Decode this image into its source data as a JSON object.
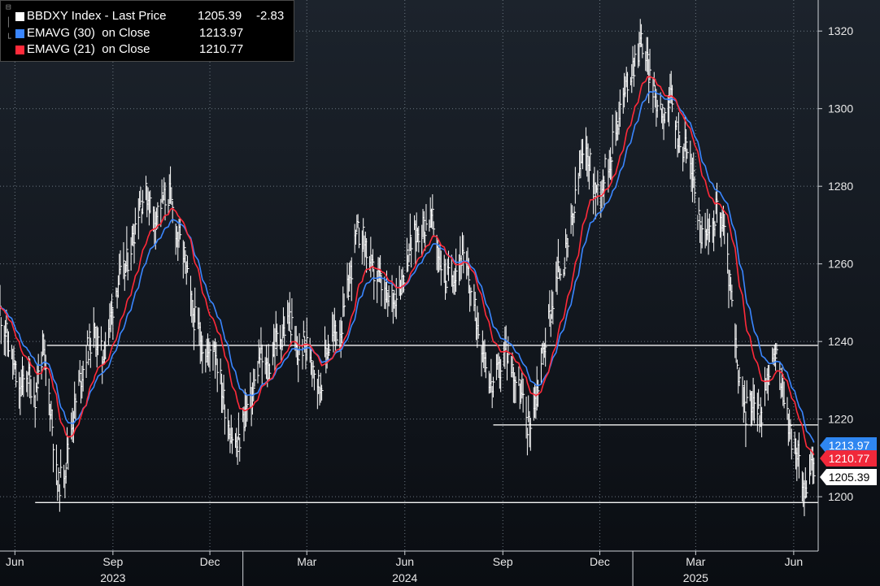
{
  "legend": {
    "items": [
      {
        "name": "BBDXY Index - Last Price",
        "value": "1205.39",
        "change": "-2.83",
        "color": "#ffffff"
      },
      {
        "name": "EMAVG (30)  on Close",
        "value": "1213.97",
        "color": "#3a86ff"
      },
      {
        "name": "EMAVG (21)  on Close",
        "value": "1210.77",
        "color": "#ff2a3a"
      }
    ]
  },
  "tags": {
    "ema30": "1213.97",
    "ema21": "1210.77",
    "last": "1205.39"
  },
  "chart_data": {
    "type": "line",
    "y_axis_side": "right",
    "ylim": [
      1186,
      1328
    ],
    "y_ticks": [
      1200,
      1220,
      1240,
      1260,
      1280,
      1300,
      1320
    ],
    "grid": true,
    "x_ticks": [
      {
        "label": "Jun",
        "date": "2023-06-01"
      },
      {
        "label": "Sep",
        "date": "2023-09-01"
      },
      {
        "label": "Dec",
        "date": "2023-12-01"
      },
      {
        "label": "Mar",
        "date": "2024-03-01"
      },
      {
        "label": "Jun",
        "date": "2024-06-01"
      },
      {
        "label": "Sep",
        "date": "2024-09-01"
      },
      {
        "label": "Dec",
        "date": "2024-12-01"
      },
      {
        "label": "Mar",
        "date": "2025-03-01"
      },
      {
        "label": "Jun",
        "date": "2025-06-01"
      }
    ],
    "year_labels": [
      {
        "label": "2023",
        "date": "2023-09-01"
      },
      {
        "label": "2024",
        "date": "2024-06-01"
      },
      {
        "label": "2025",
        "date": "2025-03-01"
      }
    ],
    "year_dividers": [
      "2024-01-01",
      "2025-01-01"
    ],
    "xlim": [
      "2023-05-18",
      "2025-06-24"
    ],
    "horizontal_lines": [
      {
        "value": 1239,
        "start": "2023-07-01",
        "end": "2025-06-24"
      },
      {
        "value": 1218.5,
        "start": "2024-08-23",
        "end": "2025-06-24"
      },
      {
        "value": 1198.5,
        "start": "2023-06-20",
        "end": "2025-06-24"
      }
    ],
    "price_anchors": [
      [
        "2023-05-18",
        1248
      ],
      [
        "2023-05-29",
        1236
      ],
      [
        "2023-06-05",
        1226
      ],
      [
        "2023-06-12",
        1232
      ],
      [
        "2023-06-20",
        1226
      ],
      [
        "2023-06-27",
        1238
      ],
      [
        "2023-07-05",
        1222
      ],
      [
        "2023-07-11",
        1202
      ],
      [
        "2023-07-18",
        1208
      ],
      [
        "2023-07-25",
        1220
      ],
      [
        "2023-08-01",
        1230
      ],
      [
        "2023-08-08",
        1238
      ],
      [
        "2023-08-15",
        1242
      ],
      [
        "2023-08-22",
        1236
      ],
      [
        "2023-08-29",
        1245
      ],
      [
        "2023-09-05",
        1255
      ],
      [
        "2023-09-12",
        1258
      ],
      [
        "2023-09-19",
        1266
      ],
      [
        "2023-09-26",
        1276
      ],
      [
        "2023-10-03",
        1278
      ],
      [
        "2023-10-10",
        1272
      ],
      [
        "2023-10-17",
        1276
      ],
      [
        "2023-10-24",
        1278
      ],
      [
        "2023-10-31",
        1268
      ],
      [
        "2023-11-07",
        1262
      ],
      [
        "2023-11-14",
        1248
      ],
      [
        "2023-11-21",
        1242
      ],
      [
        "2023-11-28",
        1236
      ],
      [
        "2023-12-05",
        1240
      ],
      [
        "2023-12-12",
        1228
      ],
      [
        "2023-12-19",
        1218
      ],
      [
        "2023-12-27",
        1212
      ],
      [
        "2024-01-03",
        1222
      ],
      [
        "2024-01-10",
        1226
      ],
      [
        "2024-01-17",
        1236
      ],
      [
        "2024-01-24",
        1232
      ],
      [
        "2024-01-31",
        1240
      ],
      [
        "2024-02-07",
        1242
      ],
      [
        "2024-02-14",
        1246
      ],
      [
        "2024-02-21",
        1236
      ],
      [
        "2024-02-28",
        1240
      ],
      [
        "2024-03-06",
        1236
      ],
      [
        "2024-03-13",
        1228
      ],
      [
        "2024-03-20",
        1238
      ],
      [
        "2024-03-27",
        1242
      ],
      [
        "2024-04-03",
        1244
      ],
      [
        "2024-04-10",
        1256
      ],
      [
        "2024-04-17",
        1268
      ],
      [
        "2024-04-24",
        1266
      ],
      [
        "2024-05-01",
        1258
      ],
      [
        "2024-05-08",
        1256
      ],
      [
        "2024-05-15",
        1250
      ],
      [
        "2024-05-22",
        1252
      ],
      [
        "2024-05-29",
        1256
      ],
      [
        "2024-06-05",
        1264
      ],
      [
        "2024-06-12",
        1268
      ],
      [
        "2024-06-19",
        1270
      ],
      [
        "2024-06-26",
        1272
      ],
      [
        "2024-07-03",
        1262
      ],
      [
        "2024-07-10",
        1256
      ],
      [
        "2024-07-17",
        1258
      ],
      [
        "2024-07-24",
        1262
      ],
      [
        "2024-07-31",
        1256
      ],
      [
        "2024-08-07",
        1246
      ],
      [
        "2024-08-14",
        1238
      ],
      [
        "2024-08-21",
        1228
      ],
      [
        "2024-08-28",
        1232
      ],
      [
        "2024-09-04",
        1238
      ],
      [
        "2024-09-11",
        1232
      ],
      [
        "2024-09-18",
        1226
      ],
      [
        "2024-09-25",
        1218
      ],
      [
        "2024-10-02",
        1226
      ],
      [
        "2024-10-09",
        1238
      ],
      [
        "2024-10-16",
        1248
      ],
      [
        "2024-10-23",
        1258
      ],
      [
        "2024-10-30",
        1262
      ],
      [
        "2024-11-06",
        1272
      ],
      [
        "2024-11-13",
        1286
      ],
      [
        "2024-11-20",
        1288
      ],
      [
        "2024-11-27",
        1278
      ],
      [
        "2024-12-04",
        1282
      ],
      [
        "2024-12-11",
        1288
      ],
      [
        "2024-12-18",
        1298
      ],
      [
        "2024-12-26",
        1306
      ],
      [
        "2025-01-02",
        1312
      ],
      [
        "2025-01-09",
        1318
      ],
      [
        "2025-01-16",
        1310
      ],
      [
        "2025-01-23",
        1302
      ],
      [
        "2025-01-30",
        1300
      ],
      [
        "2025-02-06",
        1302
      ],
      [
        "2025-02-13",
        1292
      ],
      [
        "2025-02-20",
        1290
      ],
      [
        "2025-02-27",
        1282
      ],
      [
        "2025-03-06",
        1268
      ],
      [
        "2025-03-13",
        1266
      ],
      [
        "2025-03-20",
        1274
      ],
      [
        "2025-03-27",
        1270
      ],
      [
        "2025-04-03",
        1252
      ],
      [
        "2025-04-10",
        1230
      ],
      [
        "2025-04-17",
        1222
      ],
      [
        "2025-04-24",
        1226
      ],
      [
        "2025-05-01",
        1220
      ],
      [
        "2025-05-08",
        1232
      ],
      [
        "2025-05-15",
        1236
      ],
      [
        "2025-05-22",
        1228
      ],
      [
        "2025-05-29",
        1216
      ],
      [
        "2025-06-05",
        1210
      ],
      [
        "2025-06-12",
        1202
      ],
      [
        "2025-06-19",
        1208
      ],
      [
        "2025-06-21",
        1205.39
      ]
    ],
    "series": [
      {
        "name": "BBDXY Index - Last Price",
        "style": "hlc-bars",
        "color": "#ffffff",
        "last": 1205.39
      },
      {
        "name": "EMAVG (30)  on Close",
        "style": "line",
        "color": "#3a86ff",
        "period": 30,
        "last": 1213.97
      },
      {
        "name": "EMAVG (21)  on Close",
        "style": "line",
        "color": "#ff2a3a",
        "period": 21,
        "last": 1210.77
      }
    ]
  }
}
